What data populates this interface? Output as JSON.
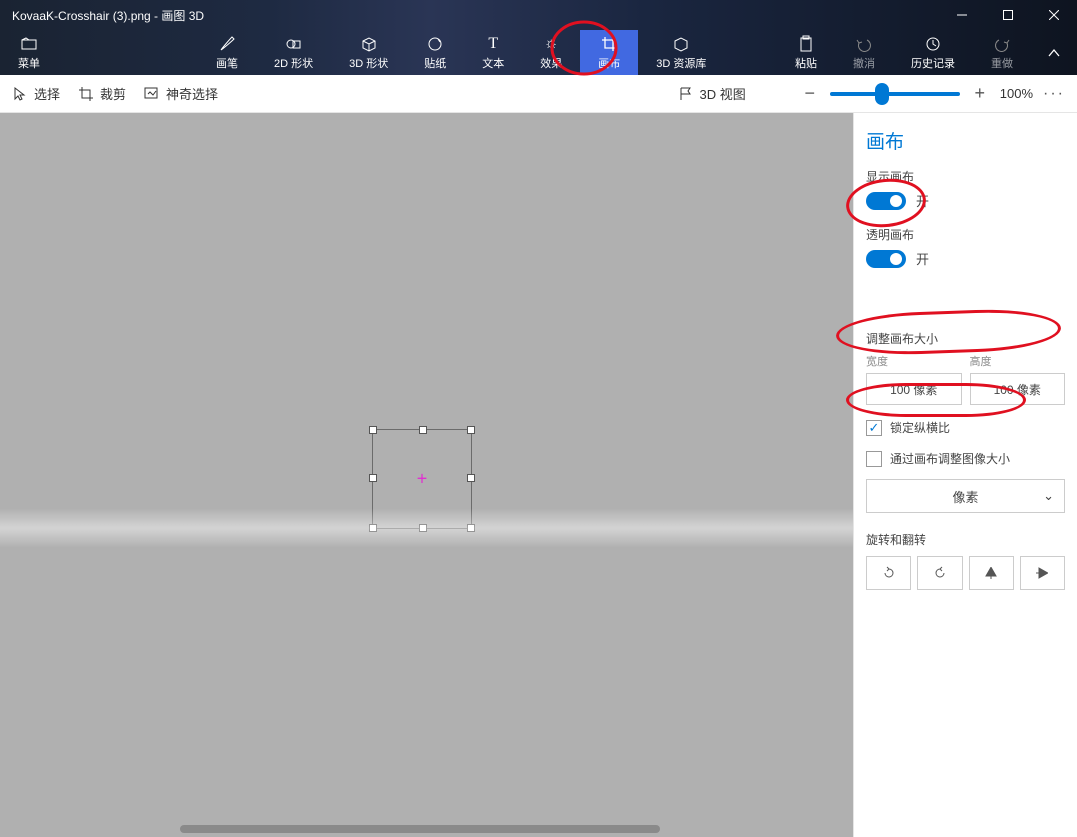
{
  "title": "KovaaK-Crosshair (3).png - 画图 3D",
  "ribbon": {
    "menu": "菜单",
    "brushes": "画笔",
    "shapes2d": "2D 形状",
    "shapes3d": "3D 形状",
    "stickers": "贴纸",
    "text": "文本",
    "effects": "效果",
    "canvas": "画布",
    "library3d": "3D 资源库",
    "paste": "粘贴",
    "undo": "撤消",
    "history": "历史记录",
    "redo": "重做"
  },
  "toolbar": {
    "select": "选择",
    "crop": "裁剪",
    "magic": "神奇选择",
    "view3d": "3D 视图",
    "zoom_pct": "100%"
  },
  "panel": {
    "title": "画布",
    "show_canvas_label": "显示画布",
    "show_canvas_state": "开",
    "transparent_label": "透明画布",
    "transparent_state": "开",
    "resize_title": "调整画布大小",
    "width_label": "宽度",
    "height_label": "高度",
    "width_value": "100 像素",
    "height_value": "100 像素",
    "lock_aspect": "锁定纵横比",
    "resize_with_canvas": "通过画布调整图像大小",
    "unit": "像素",
    "rotate_title": "旋转和翻转"
  }
}
